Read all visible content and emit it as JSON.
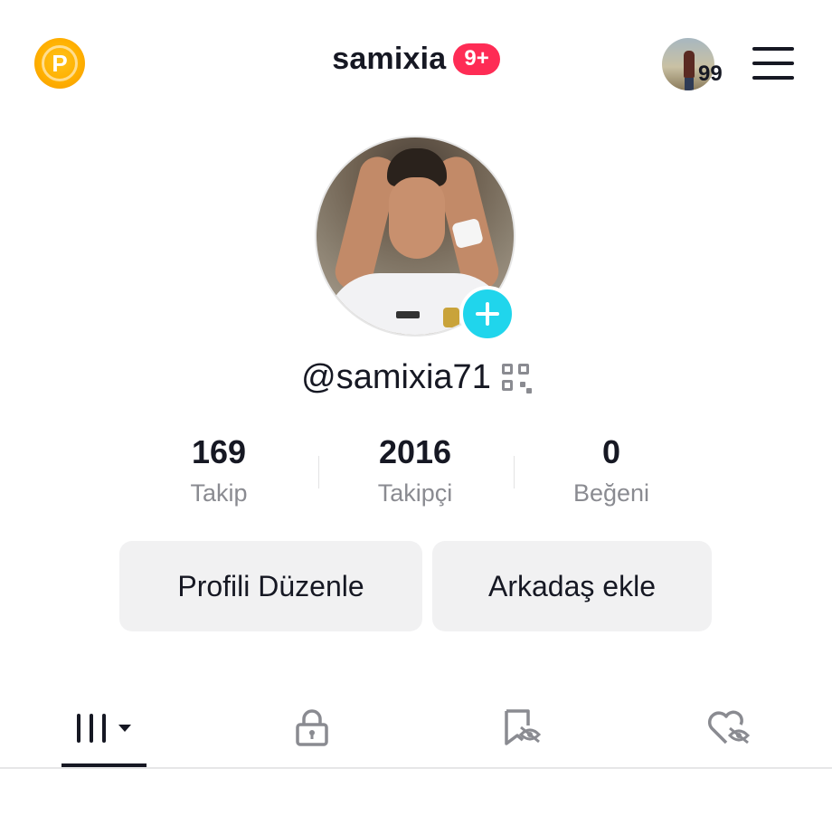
{
  "header": {
    "title": "samixia",
    "notification_badge": "9+",
    "friend_count": "99",
    "coin_label": "P"
  },
  "profile": {
    "handle": "@samixia71",
    "stats": [
      {
        "value": "169",
        "label": "Takip"
      },
      {
        "value": "2016",
        "label": "Takipçi"
      },
      {
        "value": "0",
        "label": "Beğeni"
      }
    ]
  },
  "actions": {
    "edit_profile": "Profili Düzenle",
    "add_friend": "Arkadaş ekle"
  },
  "tabs": [
    {
      "icon": "videos-grid-icon",
      "active": true
    },
    {
      "icon": "lock-icon",
      "active": false
    },
    {
      "icon": "bookmark-hidden-icon",
      "active": false
    },
    {
      "icon": "liked-hidden-icon",
      "active": false
    }
  ],
  "colors": {
    "accent_red": "#fe2c55",
    "accent_cyan": "#20d5ec",
    "coin_gold": "#ffb000",
    "text_primary": "#161823",
    "text_secondary": "#8a8b91"
  }
}
